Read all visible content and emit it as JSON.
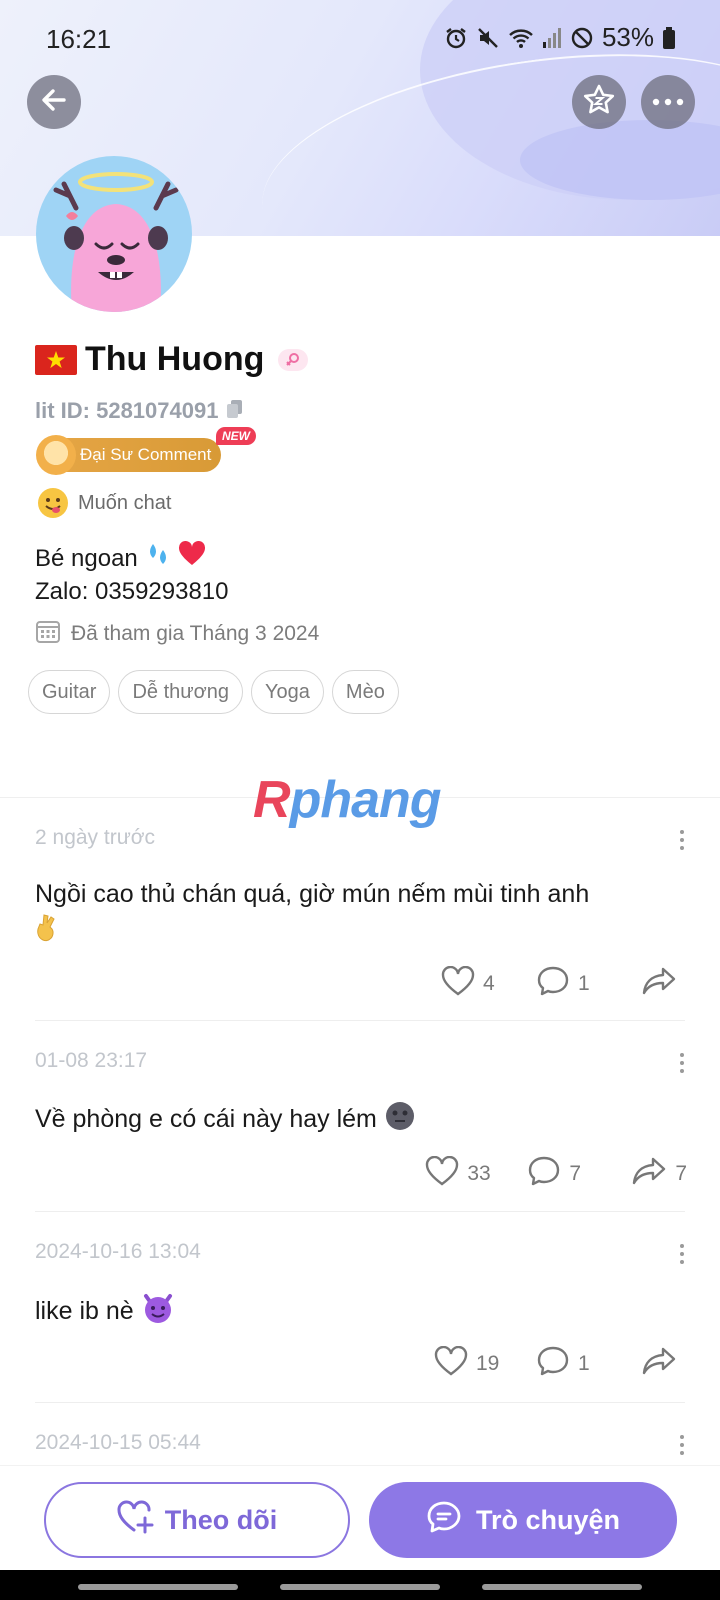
{
  "status_bar": {
    "time": "16:21",
    "battery": "53%",
    "icons": [
      "alarm-icon",
      "mute-icon",
      "wifi-icon",
      "signal-icon",
      "block-icon",
      "battery-icon"
    ]
  },
  "header": {
    "back_icon": "arrow-left-icon",
    "star_icon": "star-icon",
    "more_icon": "more-horizontal-icon"
  },
  "profile": {
    "flag": "vietnam-flag",
    "name": "Thu Huong",
    "lit_id": "lit ID: 5281074091",
    "badge_label": "Đại Sư Comment",
    "badge_new": "NEW",
    "status": "Muốn chat",
    "bio_line1": "Bé ngoan",
    "bio_line2": "Zalo: 0359293810",
    "joined": "Đã tham gia Tháng 3 2024",
    "tags": [
      "Guitar",
      "Dễ thương",
      "Yoga",
      "Mèo"
    ]
  },
  "watermark": {
    "first": "R",
    "rest": "phang"
  },
  "posts": [
    {
      "time": "2 ngày trước",
      "text": "Ngồi cao thủ chán quá, giờ mún nếm mùi tinh anh",
      "likes": "4",
      "comments": "1",
      "shares": ""
    },
    {
      "time": "01-08 23:17",
      "text": "Về phòng e có cái này hay lém",
      "likes": "33",
      "comments": "7",
      "shares": "7"
    },
    {
      "time": "2024-10-16 13:04",
      "text": "like ib nè",
      "likes": "19",
      "comments": "1",
      "shares": ""
    },
    {
      "time": "2024-10-15 05:44",
      "text": "",
      "likes": "",
      "comments": "",
      "shares": ""
    }
  ],
  "actions": {
    "follow_label": "Theo dõi",
    "chat_label": "Trò chuyện"
  },
  "colors": {
    "accent": "#8d78e6",
    "badge": "#e6a646",
    "new_badge": "#ee3d56"
  }
}
